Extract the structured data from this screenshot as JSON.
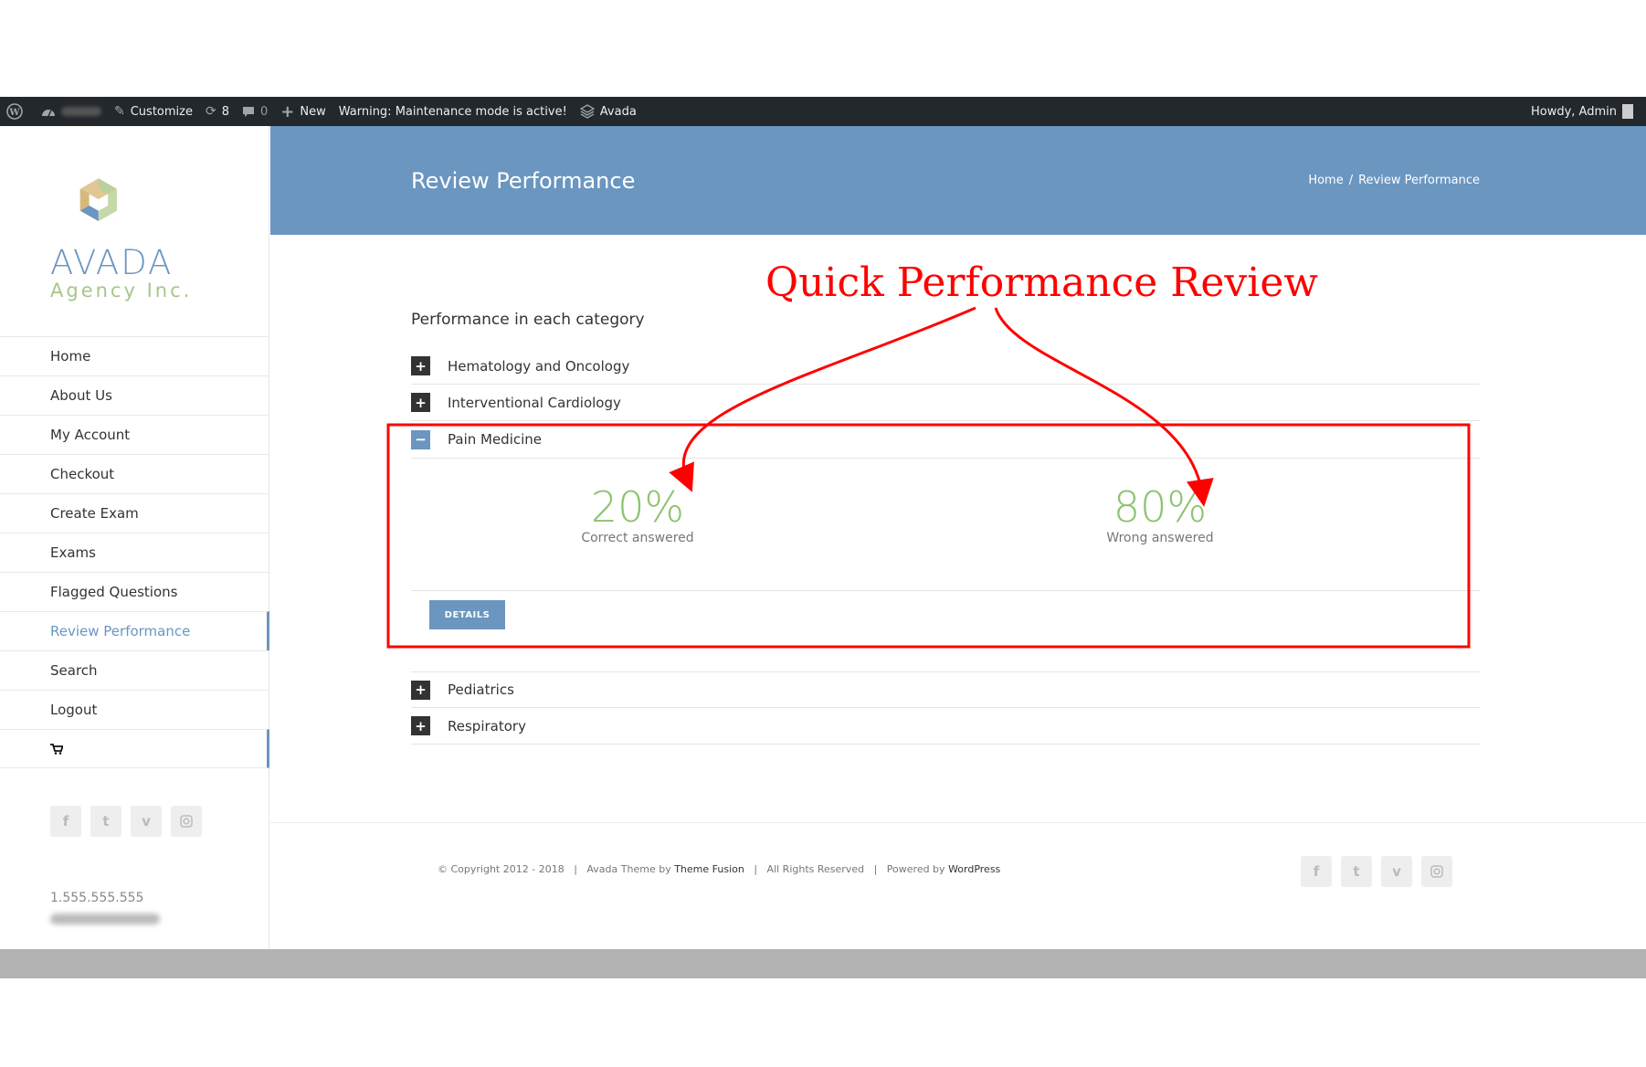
{
  "adminbar": {
    "customize": "Customize",
    "updates_count": "8",
    "comments_count": "0",
    "new_label": "New",
    "warning": "Warning: Maintenance mode is active!",
    "theme": "Avada",
    "howdy": "Howdy, Admin"
  },
  "logo": {
    "word": "AVADA",
    "sub": "Agency Inc."
  },
  "nav": [
    {
      "label": "Home"
    },
    {
      "label": "About Us"
    },
    {
      "label": "My Account"
    },
    {
      "label": "Checkout"
    },
    {
      "label": "Create Exam"
    },
    {
      "label": "Exams"
    },
    {
      "label": "Flagged Questions"
    },
    {
      "label": "Review Performance"
    },
    {
      "label": "Search"
    },
    {
      "label": "Logout"
    }
  ],
  "sidebar": {
    "phone": "1.555.555.555"
  },
  "header": {
    "title": "Review Performance",
    "breadcrumb_home": "Home",
    "breadcrumb_sep": "/",
    "breadcrumb_current": "Review Performance"
  },
  "content": {
    "section_title": "Performance in each category",
    "categories": [
      {
        "label": "Hematology and Oncology",
        "toggle": "+"
      },
      {
        "label": "Interventional Cardiology",
        "toggle": "+"
      },
      {
        "label": "Pain Medicine",
        "toggle": "−"
      },
      {
        "label": "Pediatrics",
        "toggle": "+"
      },
      {
        "label": "Respiratory",
        "toggle": "+"
      }
    ],
    "stats": {
      "correct_pct": "20%",
      "correct_caption": "Correct answered",
      "wrong_pct": "80%",
      "wrong_caption": "Wrong answered"
    },
    "details_button": "DETAILS"
  },
  "footer": {
    "copyright": "© Copyright 2012 - 2018",
    "theme_prefix": "Avada Theme by",
    "theme_link": "Theme Fusion",
    "rights": "All Rights Reserved",
    "powered_prefix": "Powered by",
    "powered_link": "WordPress",
    "sep": "|"
  },
  "annotation": {
    "title": "Quick Performance Review",
    "color": "#ff0000"
  },
  "colors": {
    "accent": "#6a96c0",
    "stat_green": "#8dc26e",
    "adminbar": "#23282d"
  }
}
